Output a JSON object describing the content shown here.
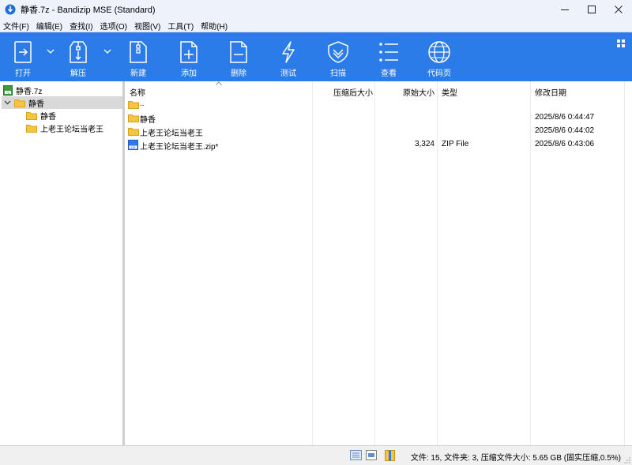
{
  "window": {
    "title": "静香.7z - Bandizip MSE (Standard)",
    "accent": "#2b7be8"
  },
  "menu": [
    {
      "label": "文件(F)"
    },
    {
      "label": "编辑(E)"
    },
    {
      "label": "查找(I)"
    },
    {
      "label": "选项(O)"
    },
    {
      "label": "视图(V)"
    },
    {
      "label": "工具(T)"
    },
    {
      "label": "帮助(H)"
    }
  ],
  "toolbar": [
    {
      "label": "打开",
      "icon": "open-icon"
    },
    {
      "label": "解压",
      "icon": "extract-icon"
    },
    {
      "label": "新建",
      "icon": "new-archive-icon"
    },
    {
      "label": "添加",
      "icon": "add-file-icon"
    },
    {
      "label": "删除",
      "icon": "delete-file-icon"
    },
    {
      "label": "测试",
      "icon": "test-icon"
    },
    {
      "label": "扫描",
      "icon": "scan-shield-icon"
    },
    {
      "label": "查看",
      "icon": "view-list-icon"
    },
    {
      "label": "代码页",
      "icon": "codepage-globe-icon"
    }
  ],
  "tree": {
    "root": "静香.7z",
    "items": [
      {
        "label": "静香"
      },
      {
        "label": "静香"
      },
      {
        "label": "上老王论坛当老王"
      }
    ]
  },
  "list": {
    "columns": [
      "名称",
      "压缩后大小",
      "原始大小",
      "类型",
      "修改日期"
    ],
    "rows": [
      {
        "name": "..",
        "packed": "",
        "size": "",
        "type": "",
        "modified": ""
      },
      {
        "name": "静香",
        "packed": "",
        "size": "",
        "type": "",
        "modified": "2025/8/6 0:44:47"
      },
      {
        "name": "上老王论坛当老王",
        "packed": "",
        "size": "",
        "type": "",
        "modified": "2025/8/6 0:44:02"
      },
      {
        "name": "上老王论坛当老王.zip*",
        "packed": "",
        "size": "3,324",
        "type": "ZIP File",
        "modified": "2025/8/6 0:43:06"
      }
    ]
  },
  "status": {
    "text": "文件: 15, 文件夹: 3, 压缩文件大小: 5.65 GB (固实压缩,0.5%)"
  }
}
